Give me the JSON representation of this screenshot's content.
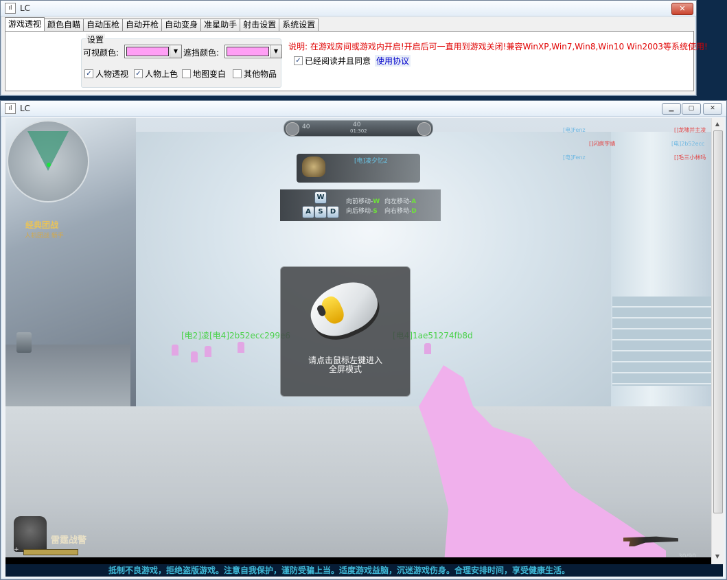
{
  "main_window": {
    "title": "LC",
    "app_icon": "ıl",
    "close_label": "✕",
    "tabs": [
      "游戏透视",
      "颜色自瞄",
      "自动压枪",
      "自动开枪",
      "自动变身",
      "准星助手",
      "射击设置",
      "系统设置"
    ],
    "active_tab": 0,
    "group_title": "设置",
    "visible_color_label": "可视颜色:",
    "visible_color_value": "#ff9ff5",
    "occlusion_color_label": "遮挡颜色:",
    "occlusion_color_value": "#ff9ff5",
    "checkboxes": [
      {
        "label": "人物透视",
        "checked": true
      },
      {
        "label": "人物上色",
        "checked": true
      },
      {
        "label": "地图变白",
        "checked": false
      },
      {
        "label": "其他物品",
        "checked": false
      }
    ],
    "note": "说明: 在游戏房间或游戏内开启!开启后可一直用到游戏关闭!兼容WinXP,Win7,Win8,Win10 Win2003等系统使用!",
    "agree_label": "已经阅读并且同意",
    "agree_checked": true,
    "agreement_link": "使用协议"
  },
  "game_window": {
    "title": "LC",
    "app_icon": "ıl",
    "mode_title": "经典团战",
    "mode_sub": "人机团战 新手",
    "score_left": "40",
    "score_mid": "40",
    "score_small": "01:302",
    "banner_name": "[电]凌夕忆2",
    "keys": [
      "W",
      "A",
      "S",
      "D"
    ],
    "hints": {
      "forward": "向前移动-",
      "forward_key": "W",
      "left": "向左移动-",
      "left_key": "A",
      "back": "向后移动-",
      "back_key": "S",
      "right": "向右移动-",
      "right_key": "D"
    },
    "killfeed": [
      {
        "left": "[电]Fenz",
        "right": "[]龙啸并主凌"
      },
      {
        "left": "[]闪疯字靖",
        "right": "[电]2b52ecc"
      },
      {
        "left": "[电]Fenz",
        "right": "[]毛三小林吗"
      }
    ],
    "enemy_tag_left": "[电2]凌[电4]2b52ecc299e6",
    "enemy_tag_right": "[电4]1ae51274fb8d",
    "popup_text_line1": "请点击鼠标左键进入",
    "popup_text_line2": "全屏模式",
    "soldier_name": "雷霆战警",
    "hp": "100",
    "ammo": "30/90",
    "marquee": "抵制不良游戏，拒绝盗版游戏。注意自我保护，谨防受骗上当。适度游戏益脑，沉迷游戏伤身。合理安排时间，享受健康生活。"
  },
  "colors": {
    "accent_pink": "#ff9ff5",
    "note_red": "#e00000",
    "link_blue": "#0000cc"
  }
}
